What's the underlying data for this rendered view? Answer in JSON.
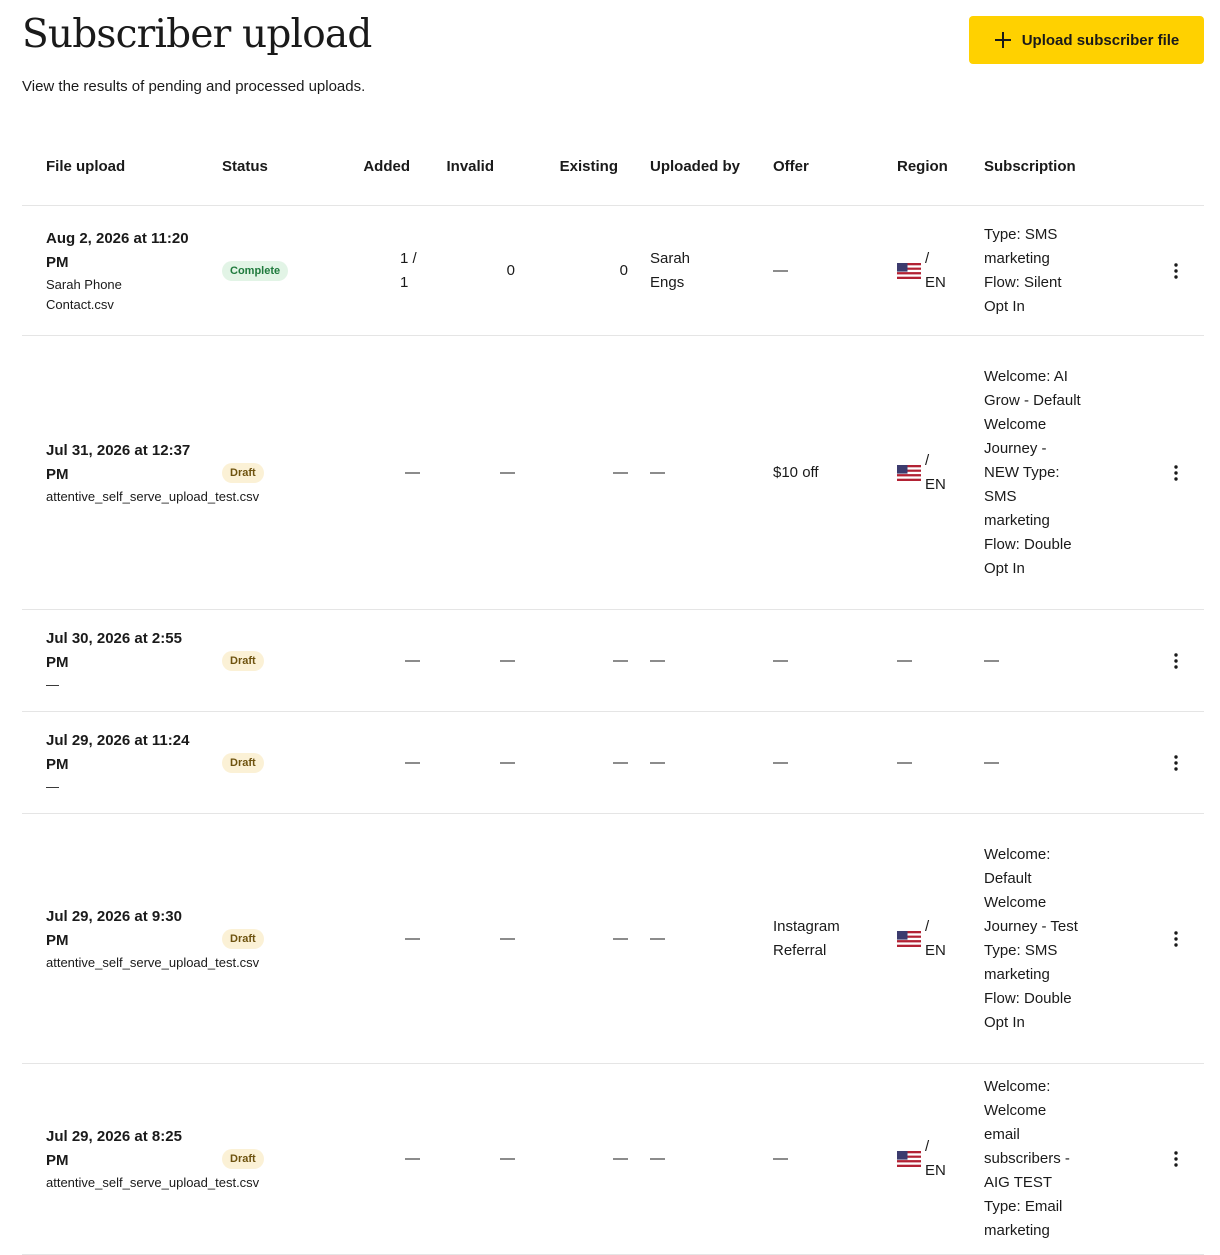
{
  "page": {
    "title": "Subscriber upload",
    "subtitle": "View the results of pending and processed uploads.",
    "upload_button_label": "Upload subscriber file",
    "accent_color": "#ffd100"
  },
  "table": {
    "headers": [
      "File upload",
      "Status",
      "Added",
      "Invalid",
      "Existing",
      "Uploaded by",
      "Offer",
      "Region",
      "Subscription"
    ],
    "rows": [
      {
        "date": "Aug 2, 2026 at 11:20 PM",
        "file": "Sarah Phone Contact.csv",
        "status": "Complete",
        "added": "1 / 1",
        "invalid": "0",
        "existing": "0",
        "uploaded_by": "Sarah Engs",
        "offer": "—",
        "region": "/ EN",
        "subscription": "Type: SMS marketing Flow: Silent Opt In"
      },
      {
        "date": "Jul 31, 2026 at 12:37 PM",
        "file": "attentive_self_serve_upload_test.csv",
        "status": "Draft",
        "added": "—",
        "invalid": "—",
        "existing": "—",
        "uploaded_by": "—",
        "offer": "$10 off",
        "region": "/ EN",
        "subscription": "Welcome: AI Grow - Default Welcome Journey - NEW Type: SMS marketing Flow: Double Opt In"
      },
      {
        "date": "Jul 30, 2026 at 2:55 PM",
        "file": "—",
        "status": "Draft",
        "added": "—",
        "invalid": "—",
        "existing": "—",
        "uploaded_by": "—",
        "offer": "—",
        "region": "—",
        "subscription": "—"
      },
      {
        "date": "Jul 29, 2026 at 11:24 PM",
        "file": "—",
        "status": "Draft",
        "added": "—",
        "invalid": "—",
        "existing": "—",
        "uploaded_by": "—",
        "offer": "—",
        "region": "—",
        "subscription": "—"
      },
      {
        "date": "Jul 29, 2026 at 9:30 PM",
        "file": "attentive_self_serve_upload_test.csv",
        "status": "Draft",
        "added": "—",
        "invalid": "—",
        "existing": "—",
        "uploaded_by": "—",
        "offer": "Instagram Referral",
        "region": "/ EN",
        "subscription": "Welcome: Default Welcome Journey - Test Type: SMS marketing Flow: Double Opt In"
      },
      {
        "date": "Jul 29, 2026 at 8:25 PM",
        "file": "attentive_self_serve_upload_test.csv",
        "status": "Draft",
        "added": "—",
        "invalid": "—",
        "existing": "—",
        "uploaded_by": "—",
        "offer": "—",
        "region": "/ EN",
        "subscription": "Welcome: Welcome email subscribers - AIG TEST Type: Email marketing"
      }
    ]
  }
}
